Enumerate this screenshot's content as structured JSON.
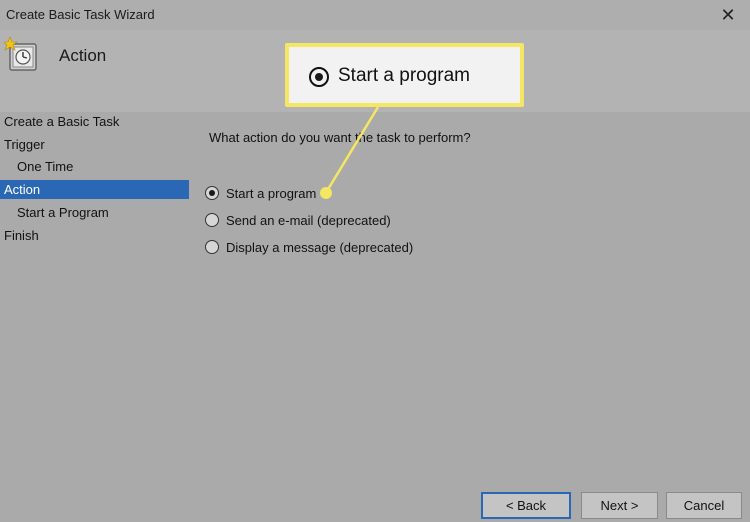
{
  "window": {
    "title": "Create Basic Task Wizard",
    "close_glyph": "✕"
  },
  "header": {
    "icon": "task-scheduler-icon",
    "title": "Action"
  },
  "sidebar": {
    "items": [
      {
        "label": "Create a Basic Task",
        "level": 0,
        "active": false
      },
      {
        "label": "Trigger",
        "level": 0,
        "active": false
      },
      {
        "label": "One Time",
        "level": 1,
        "active": false
      },
      {
        "label": "Action",
        "level": 0,
        "active": true
      },
      {
        "label": "Start a Program",
        "level": 1,
        "active": false
      },
      {
        "label": "Finish",
        "level": 0,
        "active": false
      }
    ]
  },
  "main": {
    "prompt": "What action do you want the task to perform?",
    "options": [
      {
        "label": "Start a program",
        "checked": true
      },
      {
        "label": "Send an e-mail (deprecated)",
        "checked": false
      },
      {
        "label": "Display a message (deprecated)",
        "checked": false
      }
    ]
  },
  "buttons": {
    "back": "< Back",
    "next": "Next >",
    "cancel": "Cancel"
  },
  "callout": {
    "label": "Start a program",
    "border_color": "#f5e663"
  },
  "colors": {
    "selection": "#2a68b5",
    "background": "#aaaaaa"
  }
}
